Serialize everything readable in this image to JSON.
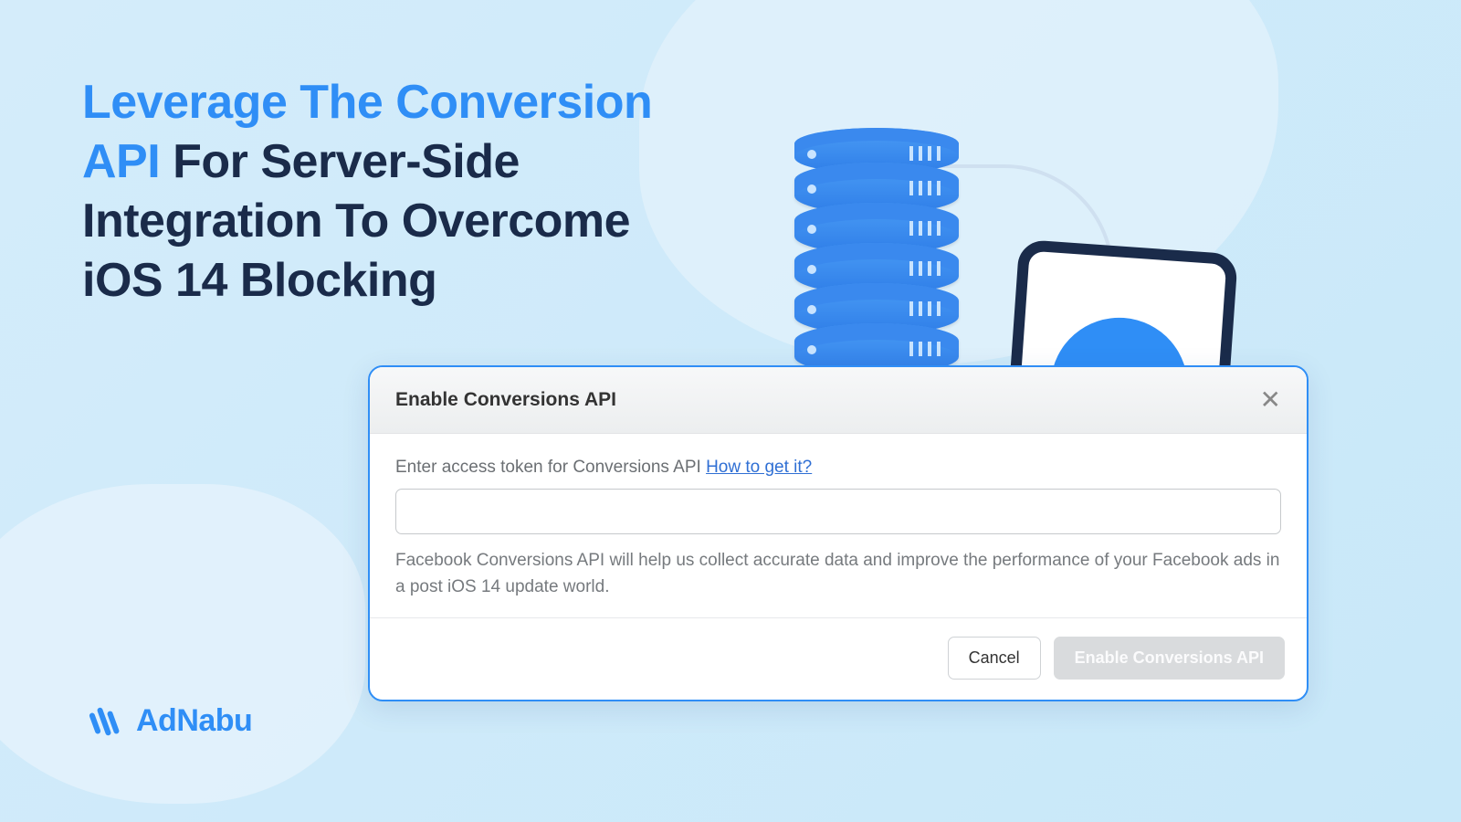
{
  "headline": {
    "part1": "Leverage The Conversion API",
    "part2": " For Server-Side Integration To Overcome iOS 14 Blocking"
  },
  "logo": {
    "text": "AdNabu"
  },
  "dialog": {
    "title": "Enable Conversions API",
    "close_glyph": "✕",
    "label_text": "Enter access token for Conversions API ",
    "label_link": "How to get it?",
    "token_value": "",
    "help_text": "Facebook Conversions API will help us collect accurate data and improve the performance of your Facebook ads in a post iOS 14 update world.",
    "cancel_label": "Cancel",
    "submit_label": "Enable Conversions API"
  },
  "colors": {
    "brand_blue": "#2f8ef6",
    "dark_navy": "#1a2b4a"
  }
}
